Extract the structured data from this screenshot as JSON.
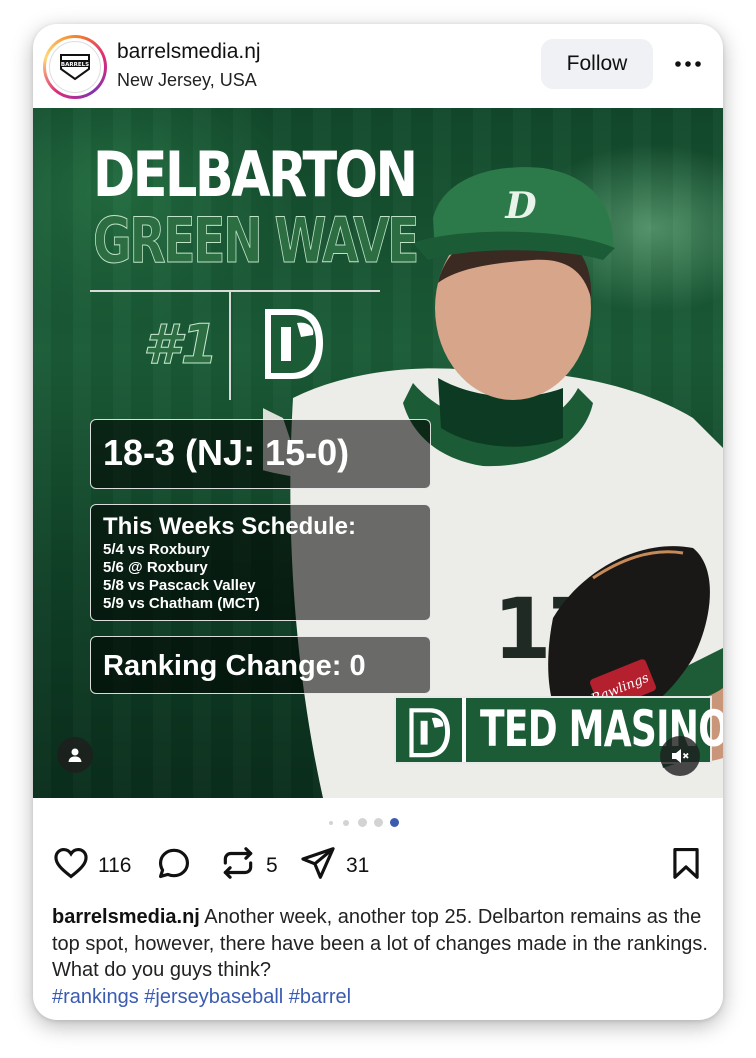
{
  "header": {
    "username": "barrelsmedia.nj",
    "location": "New Jersey, USA",
    "follow_label": "Follow",
    "avatar_text": "BARRELS"
  },
  "post": {
    "title_line1": "DELBARTON",
    "title_line2": "GREEN WAVE",
    "rank": "#1",
    "record": "18-3 (NJ: 15-0)",
    "schedule_title": "This Weeks Schedule:",
    "schedule": [
      "5/4 vs Roxbury",
      "5/6 @ Roxbury",
      "5/8 vs Pascack Valley",
      "5/9 vs Chatham (MCT)"
    ],
    "ranking_change": "Ranking Change: 0",
    "player_name": "TED MASINO",
    "jersey_number": "17",
    "colors": {
      "brand_green": "#1b5c37",
      "accent_green": "#2c6e41",
      "hashtag_blue": "#3a5bb0"
    }
  },
  "carousel": {
    "count": 4,
    "active_index": 3
  },
  "actions": {
    "likes": "116",
    "reposts": "5",
    "shares": "31",
    "icons": [
      "heart-icon",
      "comment-icon",
      "repost-icon",
      "share-icon",
      "bookmark-icon"
    ]
  },
  "caption": {
    "username": "barrelsmedia.nj",
    "text": "Another week, another top 25. Delbarton remains as the top spot, however, there have been a lot of changes made in the rankings. What do you guys think?",
    "hashtags": "#rankings #jerseybaseball #barrel"
  }
}
